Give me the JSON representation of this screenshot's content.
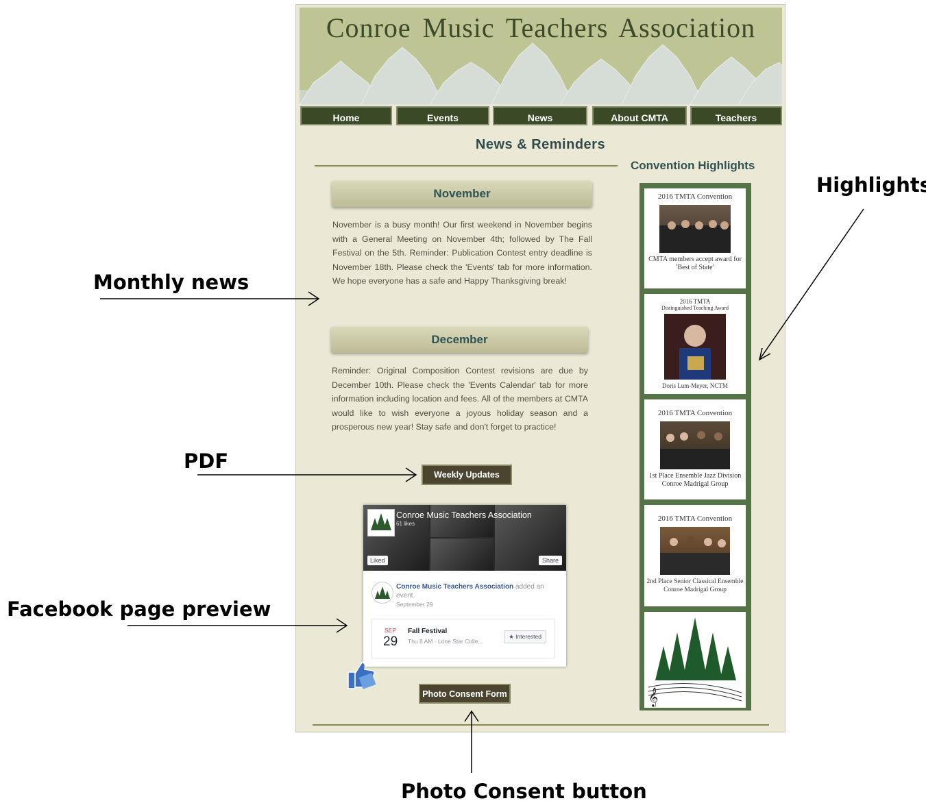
{
  "site": {
    "title": "Conroe Music Teachers Association",
    "nav": [
      "Home",
      "Events",
      "News",
      "About CMTA",
      "Teachers"
    ],
    "page_title": "News & Reminders",
    "sidebar_heading": "Convention Highlights"
  },
  "news": {
    "november": {
      "heading": "November",
      "body": "November is a busy month! Our first weekend in November begins with a General Meeting on November 4th; followed by The Fall Festival on the 5th. Reminder: Publication Contest entry deadline is November 18th. Please check the 'Events' tab for more information. We hope everyone has a safe and Happy Thanksgiving break!"
    },
    "december": {
      "heading": "December",
      "body": "Reminder: Original Composition Contest revisions are due by December 10th. Please check the 'Events Calendar' tab for more information including location and fees. All of the members at CMTA would like to wish everyone a joyous holiday season and a prosperous new year! Stay safe and don't forget to practice!"
    },
    "weekly_updates_label": "Weekly Updates",
    "photo_consent_label": "Photo Consent Form"
  },
  "facebook": {
    "page_name": "Conroe Music Teachers Association",
    "likes": "61 likes",
    "liked_label": "Liked",
    "share_label": "Share",
    "post_author": "Conroe Music Teachers Association",
    "post_action": "added an event.",
    "post_date": "September 29",
    "event_month": "SEP",
    "event_day": "29",
    "event_title": "Fall Festival",
    "event_sub": "Thu 8 AM · Lone Star Colle...",
    "interested_label": "★ Interested"
  },
  "highlights": [
    {
      "title": "2016 TMTA Convention",
      "caption": "CMTA members accept award for 'Best of State'"
    },
    {
      "title": "2016 TMTA",
      "subtitle": "Distinguished Teaching Award",
      "caption": "Doris Lum-Meyer, NCTM"
    },
    {
      "title": "2016 TMTA Convention",
      "caption": "1st Place Ensemble Jazz Division Conroe Madrigal Group"
    },
    {
      "title": "2016 TMTA Convention",
      "caption": "2nd Place Senior Classical Ensemble Conroe Madrigal Group"
    }
  ],
  "annotations": {
    "highlights": "Highlights",
    "monthly_news": "Monthly news",
    "pdf": "PDF",
    "facebook_preview": "Facebook page preview",
    "photo_consent": "Photo Consent button"
  },
  "colors": {
    "nav_bg": "#3a4a26",
    "page_bg": "#ebe9d5",
    "heading_teal": "#2f5353",
    "sidebar_green": "#557446"
  }
}
